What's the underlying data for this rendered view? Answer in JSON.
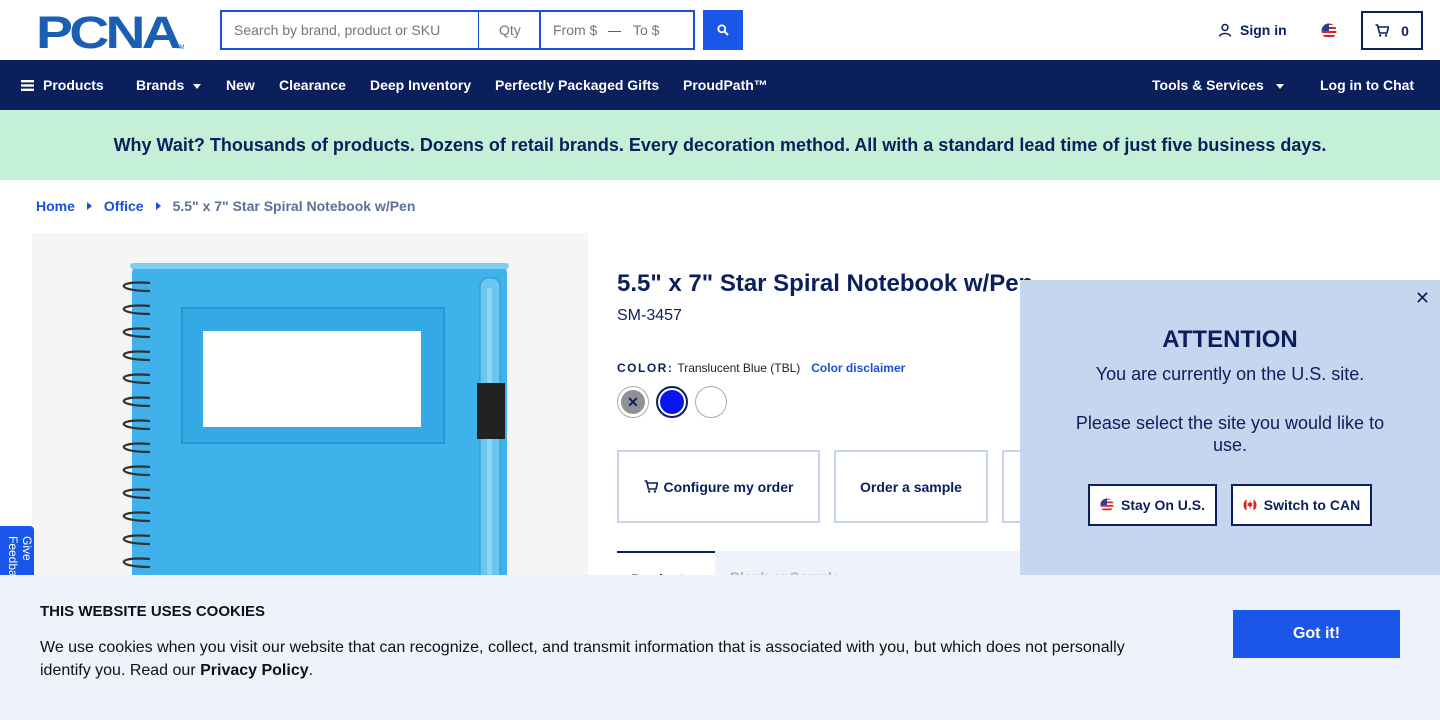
{
  "header": {
    "logo_text": "PCNA",
    "search": {
      "placeholder": "Search by brand, product or SKU",
      "value": ""
    },
    "qty": {
      "placeholder": "Qty"
    },
    "price_from": {
      "placeholder": "From $"
    },
    "price_to": {
      "placeholder": "To $"
    },
    "signin_label": "Sign in",
    "cart_count": "0"
  },
  "nav": {
    "products": "Products",
    "brands": "Brands",
    "new": "New",
    "clearance": "Clearance",
    "deep_inventory": "Deep Inventory",
    "perfectly_packaged": "Perfectly Packaged Gifts",
    "proudpath": "ProudPath™",
    "tools": "Tools & Services",
    "chat": "Log in to Chat"
  },
  "banner": {
    "text": "Why Wait? Thousands of products. Dozens of retail brands. Every decoration method. All with a standard lead time of just five business days."
  },
  "breadcrumb": {
    "home": "Home",
    "office": "Office",
    "current": "5.5\" x 7\" Star Spiral Notebook w/Pen"
  },
  "feedback_tab": "Give Feedback",
  "product": {
    "title": "5.5\" x 7\" Star Spiral Notebook w/Pen",
    "sku": "SM-3457",
    "color_label": "COLOR:",
    "color_value": "Translucent Blue (TBL)",
    "color_disclaimer": "Color disclaimer",
    "swatches": [
      {
        "name": "Translucent Gray",
        "hex": "#8f9196",
        "unavailable": true
      },
      {
        "name": "Translucent Blue",
        "hex": "#0a14ee",
        "selected": true
      },
      {
        "name": "White",
        "hex": "#ffffff"
      }
    ],
    "actions": {
      "configure": "Configure my order",
      "sample": "Order a sample"
    },
    "tabs": {
      "product": "Product",
      "blank_samples": "Blank or Sample"
    }
  },
  "attention": {
    "title": "ATTENTION",
    "line1": "You are currently on the U.S. site.",
    "line2": "Please select the site you would like to use.",
    "stay_us": "Stay On U.S.",
    "switch_can": "Switch to CAN"
  },
  "cookie": {
    "title": "THIS WEBSITE USES COOKIES",
    "text": "We use cookies when you visit our website that can recognize, collect, and transmit information that is associated with you, but which does not personally identify you. Read our ",
    "privacy": "Privacy Policy",
    "period": ".",
    "button": "Got it!"
  },
  "colors": {
    "navy": "#0a1f5c",
    "blue": "#1a56e8",
    "banner_green": "#c3f0d6",
    "attention_bg": "#c6d6ee",
    "cookie_bg": "#edf2fb",
    "product_blue": "#3fb2ec"
  },
  "icons": {
    "search": "search-icon",
    "user": "user-icon",
    "flag_us": "us-flag-icon",
    "cart": "cart-icon",
    "menu": "hamburger-icon",
    "close": "close-icon",
    "flag_ca": "canada-flag-icon"
  }
}
